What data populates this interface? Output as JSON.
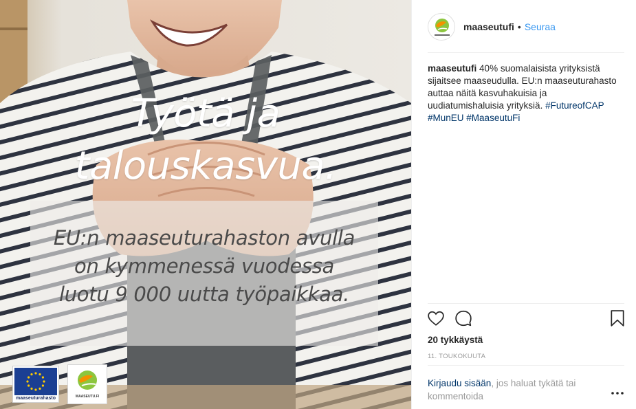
{
  "post": {
    "image": {
      "headline_line1": "Työtä ja",
      "headline_line2": "talouskasvua.",
      "subline_line1": "EU:n maaseuturahaston avulla",
      "subline_line2": "on kymmenessä vuodessa",
      "subline_line3": "luotu 9 000 uutta työpaikkaa.",
      "eu_logo_text": "maaseuturahasto",
      "maaseutu_logo_text": "MAASEUTU.FI"
    },
    "header": {
      "username": "maaseutufi",
      "separator": "•",
      "follow_label": "Seuraa",
      "avatar_text": "MAASEUTU.FI"
    },
    "caption": {
      "username": "maaseutufi",
      "text": "40% suomalaisista yrityksistä sijaitsee maaseudulla. EU:n maaseuturahasto auttaa näitä kasvuhakuisia ja uudiatumishaluisia yrityksiä.",
      "hashtag1": "#FutureofCAP",
      "hashtag2": "#MunEU",
      "hashtag3": "#MaaseutuFi"
    },
    "actions": {
      "like_icon": "heart-icon",
      "comment_icon": "comment-icon",
      "save_icon": "bookmark-icon"
    },
    "likes": "20 tykkäystä",
    "date": "11. TOUKOKUUTA",
    "login": {
      "link_text": "Kirjaudu sisään",
      "rest_text": ", jos haluat tykätä tai kommentoida",
      "more_label": "•••"
    },
    "colors": {
      "link_blue": "#3897f0",
      "hashtag_blue": "#003569",
      "eu_blue": "#1b3f93",
      "eu_yellow": "#ffcc00",
      "logo_green": "#8cc63f",
      "logo_orange": "#f39200"
    }
  }
}
